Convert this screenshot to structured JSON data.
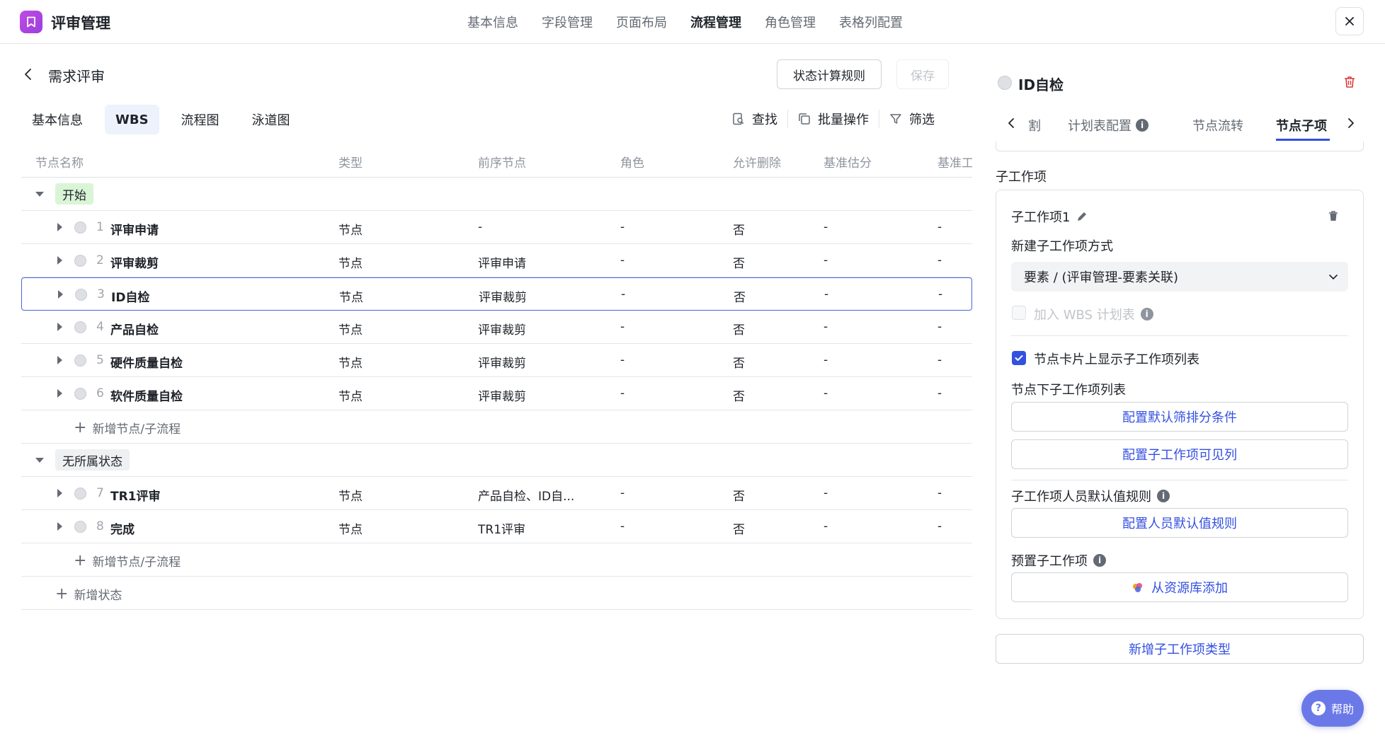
{
  "app": {
    "title": "评审管理",
    "nav": [
      "基本信息",
      "字段管理",
      "页面布局",
      "流程管理",
      "角色管理",
      "表格列配置"
    ],
    "active_nav": "流程管理"
  },
  "page": {
    "title": "需求评审",
    "rule_button": "状态计算规则",
    "save_button": "保存"
  },
  "subtabs": [
    "基本信息",
    "WBS",
    "流程图",
    "泳道图"
  ],
  "active_subtab": "WBS",
  "tools": {
    "find": "查找",
    "batch": "批量操作",
    "filter": "筛选"
  },
  "table": {
    "headers": [
      "节点名称",
      "类型",
      "前序节点",
      "角色",
      "允许删除",
      "基准估分",
      "基准工"
    ],
    "groups": [
      {
        "label": "开始",
        "rows": [
          {
            "index": "1",
            "name": "评审申请",
            "type": "节点",
            "pre": "-",
            "role": "-",
            "delete": "否",
            "score": "-",
            "work": "-"
          },
          {
            "index": "2",
            "name": "评审裁剪",
            "type": "节点",
            "pre": "评审申请",
            "role": "-",
            "delete": "否",
            "score": "-",
            "work": "-"
          },
          {
            "index": "3",
            "name": "ID自检",
            "type": "节点",
            "pre": "评审裁剪",
            "role": "-",
            "delete": "否",
            "score": "-",
            "work": "-"
          },
          {
            "index": "4",
            "name": "产品自检",
            "type": "节点",
            "pre": "评审裁剪",
            "role": "-",
            "delete": "否",
            "score": "-",
            "work": "-"
          },
          {
            "index": "5",
            "name": "硬件质量自检",
            "type": "节点",
            "pre": "评审裁剪",
            "role": "-",
            "delete": "否",
            "score": "-",
            "work": "-"
          },
          {
            "index": "6",
            "name": "软件质量自检",
            "type": "节点",
            "pre": "评审裁剪",
            "role": "-",
            "delete": "否",
            "score": "-",
            "work": "-"
          }
        ],
        "add_label": "新增节点/子流程"
      },
      {
        "label": "无所属状态",
        "rows": [
          {
            "index": "7",
            "name": "TR1评审",
            "type": "节点",
            "pre": "产品自检、ID自...",
            "role": "-",
            "delete": "否",
            "score": "-",
            "work": "-"
          },
          {
            "index": "8",
            "name": "完成",
            "type": "节点",
            "pre": "TR1评审",
            "role": "-",
            "delete": "否",
            "score": "-",
            "work": "-"
          }
        ],
        "add_label": "新增节点/子流程"
      }
    ],
    "add_state_label": "新增状态"
  },
  "right_panel": {
    "title": "ID自检",
    "tabs": [
      "割",
      "计划表配置",
      "节点流转",
      "节点子项"
    ],
    "active_tab": "节点子项",
    "section_title": "子工作项",
    "card": {
      "item_name": "子工作项1",
      "create_method_label": "新建子工作项方式",
      "create_method_value": "要素 / (评审管理-要素关联)",
      "join_wbs_label": "加入 WBS 计划表",
      "join_wbs_checked": false,
      "show_list_label": "节点卡片上显示子工作项列表",
      "show_list_checked": true,
      "list_label": "节点下子工作项列表",
      "btn_filter": "配置默认筛排分条件",
      "btn_columns": "配置子工作项可见列",
      "person_rule_label": "子工作项人员默认值规则",
      "btn_person": "配置人员默认值规则",
      "preset_label": "预置子工作项",
      "btn_library": "从资源库添加"
    },
    "add_type_button": "新增子工作项类型"
  },
  "help": {
    "label": "帮助"
  },
  "colors": {
    "accent": "#3350e0",
    "logo": "#c04be0",
    "start_tag": "#d9f5d6"
  }
}
